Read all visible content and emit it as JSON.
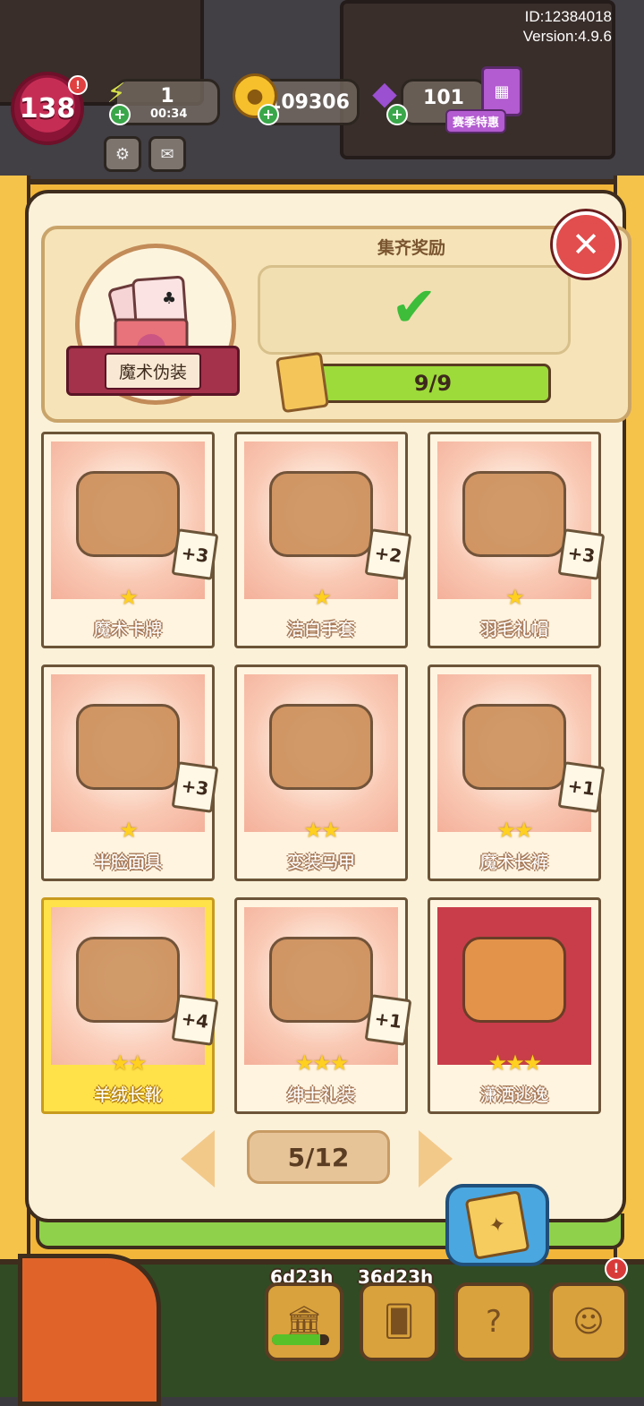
{
  "system": {
    "id_text": "ID:12384018",
    "version_text": "Version:4.9.6"
  },
  "hud": {
    "level": "138",
    "level_badge_count": "!",
    "energy": {
      "value": "1",
      "timer": "00:34"
    },
    "coins": "109306",
    "gems": "101",
    "season_tag": "赛季特惠"
  },
  "panel": {
    "reward_title": "集齐奖励",
    "set_name": "魔术伪装",
    "progress_text": "9/9",
    "progress_fraction": 1.0,
    "close_symbol": "✕",
    "check_symbol": "✔"
  },
  "cards": [
    {
      "name": "魔术卡牌",
      "stars": "★",
      "dup": "+3",
      "gold": false,
      "special": false
    },
    {
      "name": "洁白手套",
      "stars": "★",
      "dup": "+2",
      "gold": false,
      "special": false
    },
    {
      "name": "羽毛礼帽",
      "stars": "★",
      "dup": "+3",
      "gold": false,
      "special": false
    },
    {
      "name": "半脸面具",
      "stars": "★",
      "dup": "+3",
      "gold": false,
      "special": false
    },
    {
      "name": "变装马甲",
      "stars": "★★",
      "dup": "",
      "gold": false,
      "special": false
    },
    {
      "name": "魔术长裤",
      "stars": "★★",
      "dup": "+1",
      "gold": false,
      "special": false
    },
    {
      "name": "羊绒长靴",
      "stars": "★★",
      "dup": "+4",
      "gold": true,
      "special": false
    },
    {
      "name": "绅士礼装",
      "stars": "★★★",
      "dup": "+1",
      "gold": false,
      "special": false
    },
    {
      "name": "潇洒逃逸",
      "stars": "★★★",
      "dup": "",
      "gold": false,
      "special": true
    }
  ],
  "pager": {
    "page": "5/12"
  },
  "bottom_bar": {
    "timers": [
      "6d23h",
      "36d23h"
    ],
    "icons": [
      "pillar-icon",
      "cards-icon",
      "mystery-icon",
      "character-icon"
    ],
    "progress_fraction": 0.85,
    "warn": "!"
  },
  "colors": {
    "accent": "#f2b63a",
    "progress": "#9ddb3a",
    "close": "#e24d4d",
    "gold_card": "#ffe24a"
  }
}
